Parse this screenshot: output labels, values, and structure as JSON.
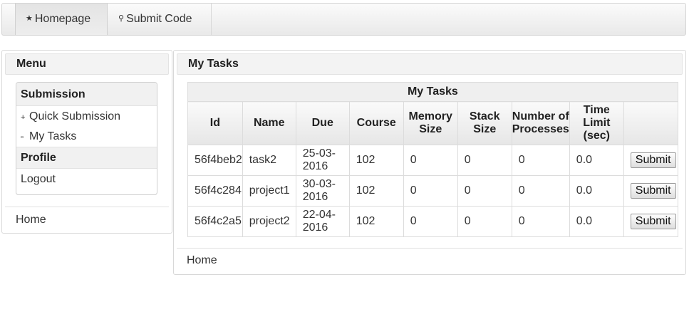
{
  "nav": {
    "items": [
      {
        "label": "Homepage",
        "icon": "star-icon",
        "glyph": "★"
      },
      {
        "label": "Submit Code",
        "icon": "search-icon",
        "glyph": "⚲"
      }
    ]
  },
  "sidebar": {
    "title": "Menu",
    "submission_header": "Submission",
    "quick_submission": {
      "label": "Quick Submission",
      "glyph": "+"
    },
    "my_tasks": {
      "label": "My Tasks",
      "glyph": "▫"
    },
    "profile_header": "Profile",
    "logout": "Logout",
    "footer": "Home"
  },
  "main": {
    "title": "My Tasks",
    "table": {
      "caption": "My Tasks",
      "headers": [
        "Id",
        "Name",
        "Due",
        "Course",
        "Memory Size",
        "Stack Size",
        "Number of Processes",
        "Time Limit (sec)",
        ""
      ],
      "rows": [
        {
          "id": "56f4beb2",
          "name": "task2",
          "due_top": "25-03-",
          "due_bottom": "2016",
          "course": "102",
          "memory": "0",
          "stack": "0",
          "processes": "0",
          "time": "0.0",
          "action": "Submit"
        },
        {
          "id": "56f4c284",
          "name": "project1",
          "due_top": "30-03-",
          "due_bottom": "2016",
          "course": "102",
          "memory": "0",
          "stack": "0",
          "processes": "0",
          "time": "0.0",
          "action": "Submit"
        },
        {
          "id": "56f4c2a5",
          "name": "project2",
          "due_top": "22-04-",
          "due_bottom": "2016",
          "course": "102",
          "memory": "0",
          "stack": "0",
          "processes": "0",
          "time": "0.0",
          "action": "Submit"
        }
      ]
    },
    "footer": "Home"
  }
}
